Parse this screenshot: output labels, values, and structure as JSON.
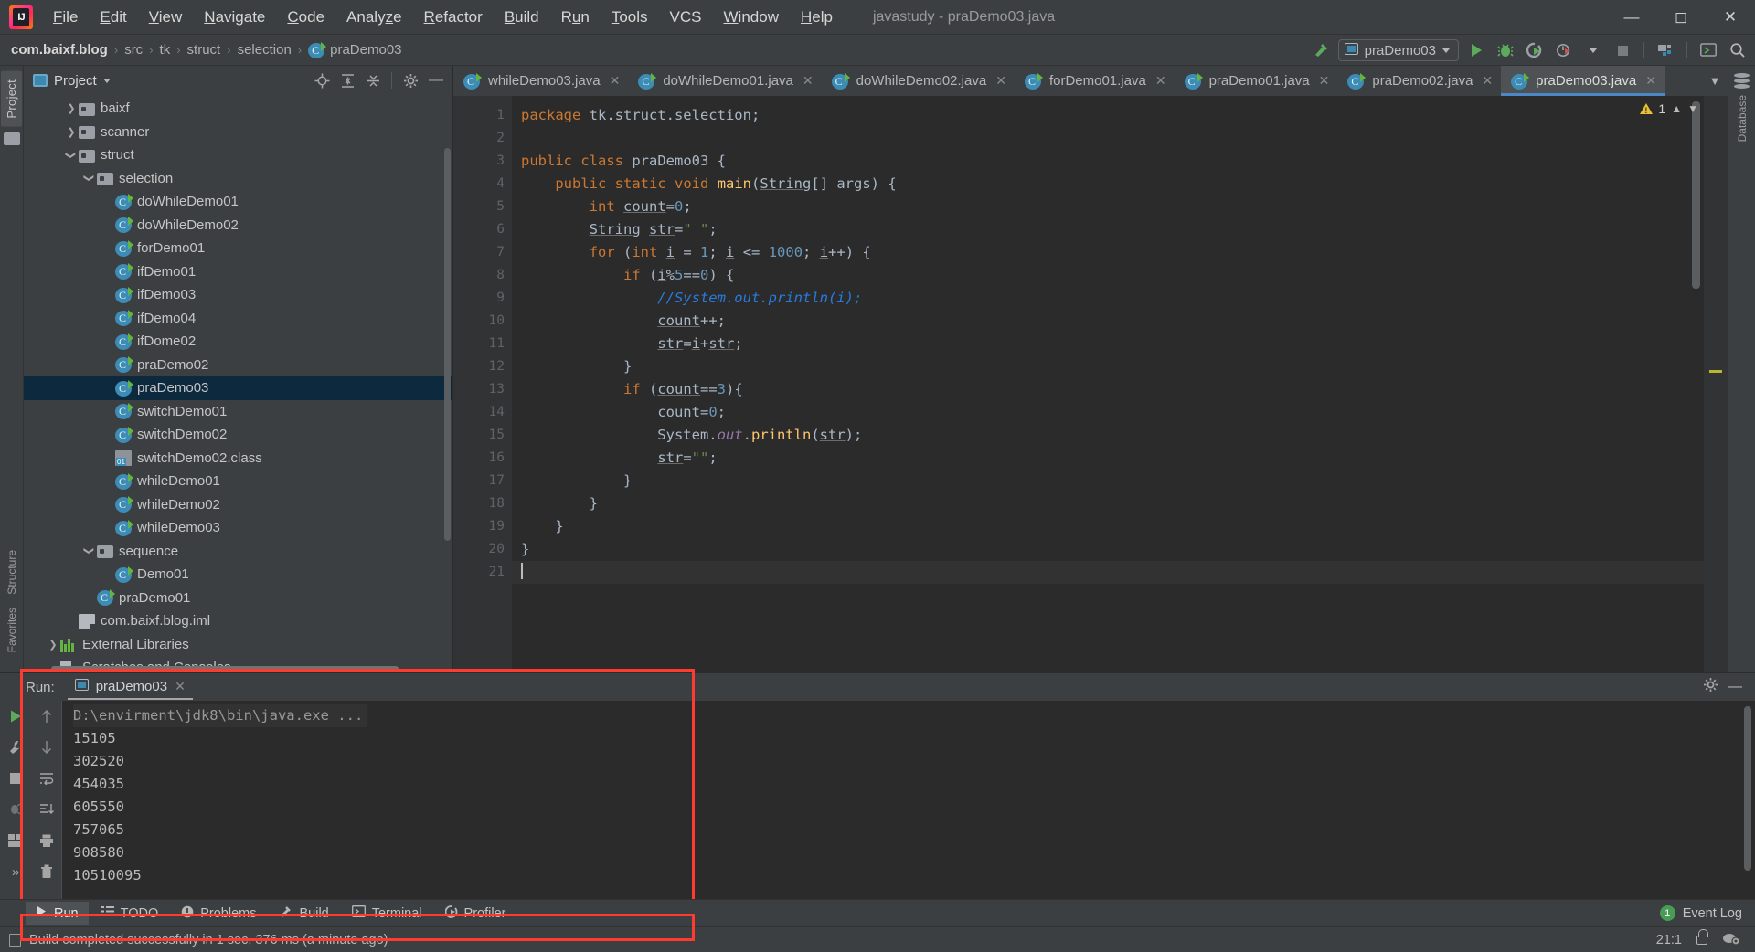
{
  "window": {
    "title": "javastudy - praDemo03.java",
    "controls": [
      "minimize",
      "maximize",
      "close"
    ]
  },
  "menubar": {
    "items": [
      {
        "label": "File",
        "accel": "F"
      },
      {
        "label": "Edit",
        "accel": "E"
      },
      {
        "label": "View",
        "accel": "V"
      },
      {
        "label": "Navigate",
        "accel": "N"
      },
      {
        "label": "Code",
        "accel": "C"
      },
      {
        "label": "Analyze",
        "accel": "z"
      },
      {
        "label": "Refactor",
        "accel": "R"
      },
      {
        "label": "Build",
        "accel": "B"
      },
      {
        "label": "Run",
        "accel": "u"
      },
      {
        "label": "Tools",
        "accel": "T"
      },
      {
        "label": "VCS",
        "accel": ""
      },
      {
        "label": "Window",
        "accel": "W"
      },
      {
        "label": "Help",
        "accel": "H"
      }
    ]
  },
  "breadcrumb": {
    "items": [
      "com.baixf.blog",
      "src",
      "tk",
      "struct",
      "selection",
      "praDemo03"
    ],
    "separator": "›"
  },
  "toolbar": {
    "run_config": "praDemo03",
    "icons": [
      "build-hammer-icon",
      "run-icon",
      "debug-icon",
      "run-coverage-icon",
      "profile-icon",
      "stop-icon",
      "project-structure-icon",
      "terminal-icon",
      "search-everywhere-icon"
    ]
  },
  "left_rail": {
    "project_tab": "Project",
    "bottom_tabs": [
      "Structure",
      "Favorites"
    ]
  },
  "project_panel": {
    "title": "Project",
    "actions": [
      "locate-icon",
      "expand-all-icon",
      "collapse-all-icon",
      "settings-gear-icon",
      "hide-icon"
    ],
    "tree": [
      {
        "label": "baixf",
        "indent": 2,
        "arrow": "collapsed",
        "icon": "folder-icon"
      },
      {
        "label": "scanner",
        "indent": 2,
        "arrow": "collapsed",
        "icon": "folder-icon"
      },
      {
        "label": "struct",
        "indent": 2,
        "arrow": "expanded",
        "icon": "folder-icon"
      },
      {
        "label": "selection",
        "indent": 3,
        "arrow": "expanded",
        "icon": "folder-icon"
      },
      {
        "label": "doWhileDemo01",
        "indent": 4,
        "arrow": "none",
        "icon": "java-class-icon"
      },
      {
        "label": "doWhileDemo02",
        "indent": 4,
        "arrow": "none",
        "icon": "java-class-icon"
      },
      {
        "label": "forDemo01",
        "indent": 4,
        "arrow": "none",
        "icon": "java-class-icon"
      },
      {
        "label": "ifDemo01",
        "indent": 4,
        "arrow": "none",
        "icon": "java-class-icon"
      },
      {
        "label": "ifDemo03",
        "indent": 4,
        "arrow": "none",
        "icon": "java-class-icon"
      },
      {
        "label": "ifDemo04",
        "indent": 4,
        "arrow": "none",
        "icon": "java-class-icon"
      },
      {
        "label": "ifDome02",
        "indent": 4,
        "arrow": "none",
        "icon": "java-class-icon"
      },
      {
        "label": "praDemo02",
        "indent": 4,
        "arrow": "none",
        "icon": "java-class-icon"
      },
      {
        "label": "praDemo03",
        "indent": 4,
        "arrow": "none",
        "icon": "java-class-icon",
        "selected": true
      },
      {
        "label": "switchDemo01",
        "indent": 4,
        "arrow": "none",
        "icon": "java-class-icon"
      },
      {
        "label": "switchDemo02",
        "indent": 4,
        "arrow": "none",
        "icon": "java-class-icon"
      },
      {
        "label": "switchDemo02.class",
        "indent": 4,
        "arrow": "none",
        "icon": "class-file-icon"
      },
      {
        "label": "whileDemo01",
        "indent": 4,
        "arrow": "none",
        "icon": "java-class-icon"
      },
      {
        "label": "whileDemo02",
        "indent": 4,
        "arrow": "none",
        "icon": "java-class-icon"
      },
      {
        "label": "whileDemo03",
        "indent": 4,
        "arrow": "none",
        "icon": "java-class-icon"
      },
      {
        "label": "sequence",
        "indent": 3,
        "arrow": "expanded",
        "icon": "folder-icon"
      },
      {
        "label": "Demo01",
        "indent": 4,
        "arrow": "none",
        "icon": "java-class-icon"
      },
      {
        "label": "praDemo01",
        "indent": 3,
        "arrow": "none",
        "icon": "java-class-icon"
      },
      {
        "label": "com.baixf.blog.iml",
        "indent": 2,
        "arrow": "none",
        "icon": "iml-file-icon"
      },
      {
        "label": "External Libraries",
        "indent": 1,
        "arrow": "collapsed",
        "icon": "libraries-icon"
      },
      {
        "label": "Scratches and Consoles",
        "indent": 1,
        "arrow": "none",
        "icon": "scratches-icon"
      }
    ]
  },
  "editor": {
    "tabs": [
      {
        "label": "whileDemo03.java",
        "active": false
      },
      {
        "label": "doWhileDemo01.java",
        "active": false
      },
      {
        "label": "doWhileDemo02.java",
        "active": false
      },
      {
        "label": "forDemo01.java",
        "active": false
      },
      {
        "label": "praDemo01.java",
        "active": false
      },
      {
        "label": "praDemo02.java",
        "active": false
      },
      {
        "label": "praDemo03.java",
        "active": true
      }
    ],
    "inspection": {
      "warning_count": "1",
      "up": "⌃",
      "down": "⌄"
    },
    "lines": [
      {
        "no": "1"
      },
      {
        "no": "2"
      },
      {
        "no": "3",
        "run": true
      },
      {
        "no": "4",
        "run": true,
        "fold": true
      },
      {
        "no": "5"
      },
      {
        "no": "6"
      },
      {
        "no": "7",
        "fold": true
      },
      {
        "no": "8",
        "fold": true
      },
      {
        "no": "9"
      },
      {
        "no": "10"
      },
      {
        "no": "11"
      },
      {
        "no": "12",
        "fold": true
      },
      {
        "no": "13",
        "fold": true
      },
      {
        "no": "14"
      },
      {
        "no": "15"
      },
      {
        "no": "16"
      },
      {
        "no": "17",
        "fold": true
      },
      {
        "no": "18",
        "fold": true
      },
      {
        "no": "19",
        "fold": true
      },
      {
        "no": "20"
      },
      {
        "no": "21",
        "current": true
      }
    ],
    "code_text": [
      "package tk.struct.selection;",
      "",
      "public class praDemo03 {",
      "    public static void main(String[] args) {",
      "        int count=0;",
      "        String str=\" \";",
      "        for (int i = 1; i <= 1000; i++) {",
      "            if (i%5==0) {",
      "                //System.out.println(i);",
      "                count++;",
      "                str=i+str;",
      "            }",
      "            if (count==3){",
      "                count=0;",
      "                System.out.println(str);",
      "                str=\"\";",
      "            }",
      "        }",
      "    }",
      "}",
      ""
    ]
  },
  "right_rail": {
    "database_tab": "Database"
  },
  "run_panel": {
    "label": "Run:",
    "tab": "praDemo03",
    "side_icons": [
      "rerun-icon",
      "settings-wrench-icon",
      "stop-icon",
      "debug-attach-icon",
      "layout-icon",
      "more-icon"
    ],
    "side_icons2": [
      "scroll-up-icon",
      "scroll-down-icon",
      "soft-wrap-icon",
      "scroll-to-end-icon",
      "print-icon",
      "clear-all-icon"
    ],
    "header_icons": [
      "gear-icon",
      "hide-icon"
    ],
    "console": [
      "D:\\envirment\\jdk8\\bin\\java.exe ...",
      "15105",
      "302520",
      "454035",
      "605550",
      "757065",
      "908580",
      "10510095"
    ]
  },
  "bottom_tabs": {
    "items": [
      {
        "label": "Run",
        "icon": "run-icon",
        "active": true
      },
      {
        "label": "TODO",
        "icon": "todo-icon",
        "active": false
      },
      {
        "label": "Problems",
        "icon": "problems-icon",
        "active": false
      },
      {
        "label": "Build",
        "icon": "build-hammer-icon",
        "active": false
      },
      {
        "label": "Terminal",
        "icon": "terminal-icon",
        "active": false
      },
      {
        "label": "Profiler",
        "icon": "profiler-icon",
        "active": false
      }
    ],
    "event_log": {
      "count": "1",
      "label": "Event Log"
    }
  },
  "statusbar": {
    "message": "Build completed successfully in 1 sec, 376 ms (a minute ago)",
    "caret_position": "21:1",
    "icons": [
      "lock-icon",
      "settings-cloud-icon"
    ]
  },
  "colors": {
    "accent_blue": "#4a88c7",
    "selection_bg": "#0d293e",
    "green_run": "#5caa5c",
    "warning_yellow": "#e8bf35",
    "highlight_box": "#ff3b30"
  }
}
